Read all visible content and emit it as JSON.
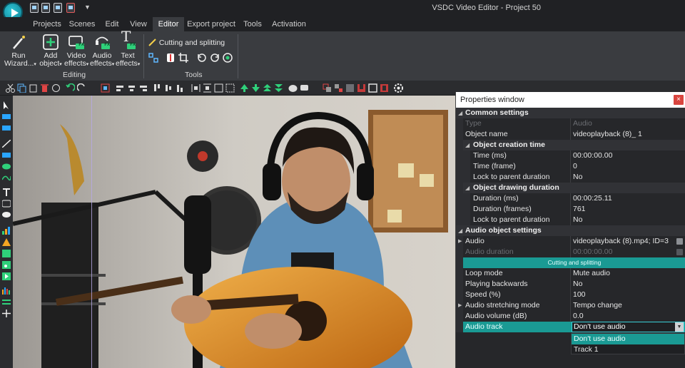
{
  "app": {
    "title": "VSDC Video Editor - Project 50",
    "logo_icon": "vsdc-logo-icon",
    "quick_access_dropdown": "▼"
  },
  "menu": {
    "tabs": [
      {
        "label": "Projects"
      },
      {
        "label": "Scenes"
      },
      {
        "label": "Edit"
      },
      {
        "label": "View"
      },
      {
        "label": "Editor",
        "active": true
      },
      {
        "label": "Export project"
      },
      {
        "label": "Tools"
      },
      {
        "label": "Activation"
      }
    ]
  },
  "ribbon": {
    "run_wizard": {
      "line1": "Run",
      "line2": "Wizard..."
    },
    "add_object": {
      "line1": "Add",
      "line2": "object"
    },
    "video_effects": {
      "line1": "Video",
      "line2": "effects"
    },
    "audio_effects": {
      "line1": "Audio",
      "line2": "effects"
    },
    "text_effects": {
      "line1": "Text",
      "line2": "effects"
    },
    "fx_badge": "FX",
    "text_icon_letter": "T",
    "editing_label": "Editing",
    "cutting_splitting": "Cutting and splitting",
    "tools_label": "Tools"
  },
  "properties": {
    "title": "Properties window",
    "close": "×",
    "rows": {
      "common": {
        "label": "Common settings"
      },
      "type": {
        "label": "Type",
        "value": "Audio"
      },
      "object_name": {
        "label": "Object name",
        "value": "videoplayback (8)_ 1"
      },
      "creation_time": {
        "label": "Object creation time"
      },
      "time_ms": {
        "label": "Time (ms)",
        "value": "00:00:00.00"
      },
      "time_frame": {
        "label": "Time (frame)",
        "value": "0"
      },
      "lock_parent_1": {
        "label": "Lock to parent duration",
        "value": "No"
      },
      "drawing_duration": {
        "label": "Object drawing duration"
      },
      "duration_ms": {
        "label": "Duration (ms)",
        "value": "00:00:25.11"
      },
      "duration_frames": {
        "label": "Duration (frames)",
        "value": "761"
      },
      "lock_parent_2": {
        "label": "Lock to parent duration",
        "value": "No"
      },
      "audio_settings": {
        "label": "Audio object settings"
      },
      "audio": {
        "label": "Audio",
        "value": "videoplayback (8).mp4; ID=3"
      },
      "audio_duration": {
        "label": "Audio duration",
        "value": "00:00:00.00"
      },
      "cutting_splitting": {
        "label": "Cutting and splitting"
      },
      "loop_mode": {
        "label": "Loop mode",
        "value": "Mute audio"
      },
      "playing_backwards": {
        "label": "Playing backwards",
        "value": "No"
      },
      "speed": {
        "label": "Speed (%)",
        "value": "100"
      },
      "stretching": {
        "label": "Audio stretching mode",
        "value": "Tempo change"
      },
      "volume": {
        "label": "Audio volume (dB)",
        "value": "0.0"
      },
      "audio_track": {
        "label": "Audio track",
        "value": "Don't use audio"
      }
    },
    "audio_track_options": [
      "Don't use audio",
      "Track 1"
    ],
    "selected_option_index": 0
  },
  "colors": {
    "accent_teal": "#1a9a94",
    "close_red": "#d9453f",
    "background_dark": "#1e1f21",
    "ribbon": "#3a3c40"
  }
}
